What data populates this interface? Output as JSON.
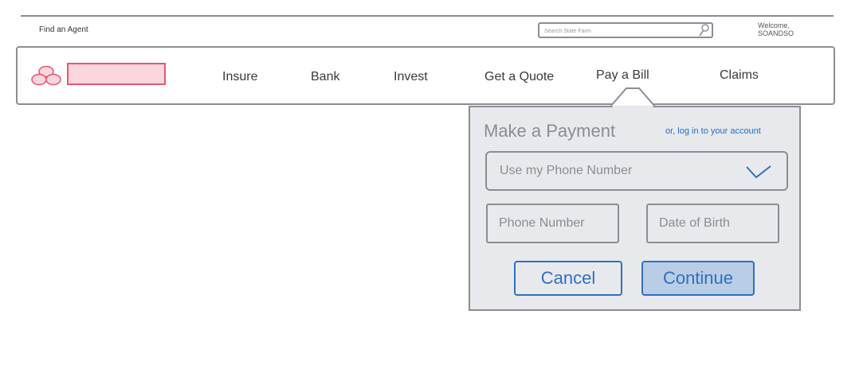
{
  "topbar": {
    "find_agent": "Find an Agent",
    "search_placeholder": "Search State Farm",
    "welcome_line1": "Welcome,",
    "welcome_line2": "SOANDSO"
  },
  "nav": {
    "items": [
      {
        "label": "Insure"
      },
      {
        "label": "Bank"
      },
      {
        "label": "Invest"
      },
      {
        "label": "Get a Quote"
      },
      {
        "label": "Pay a Bill"
      },
      {
        "label": "Claims"
      }
    ],
    "brand_color": "#e35874",
    "brand_fill": "#fbd6df"
  },
  "payment": {
    "title": "Make a Payment",
    "login_link": "or, log in to your account",
    "method_selected": "Use my Phone Number",
    "phone_placeholder": "Phone Number",
    "dob_placeholder": "Date of Birth",
    "cancel_label": "Cancel",
    "continue_label": "Continue",
    "accent_color": "#2f6fc2"
  }
}
